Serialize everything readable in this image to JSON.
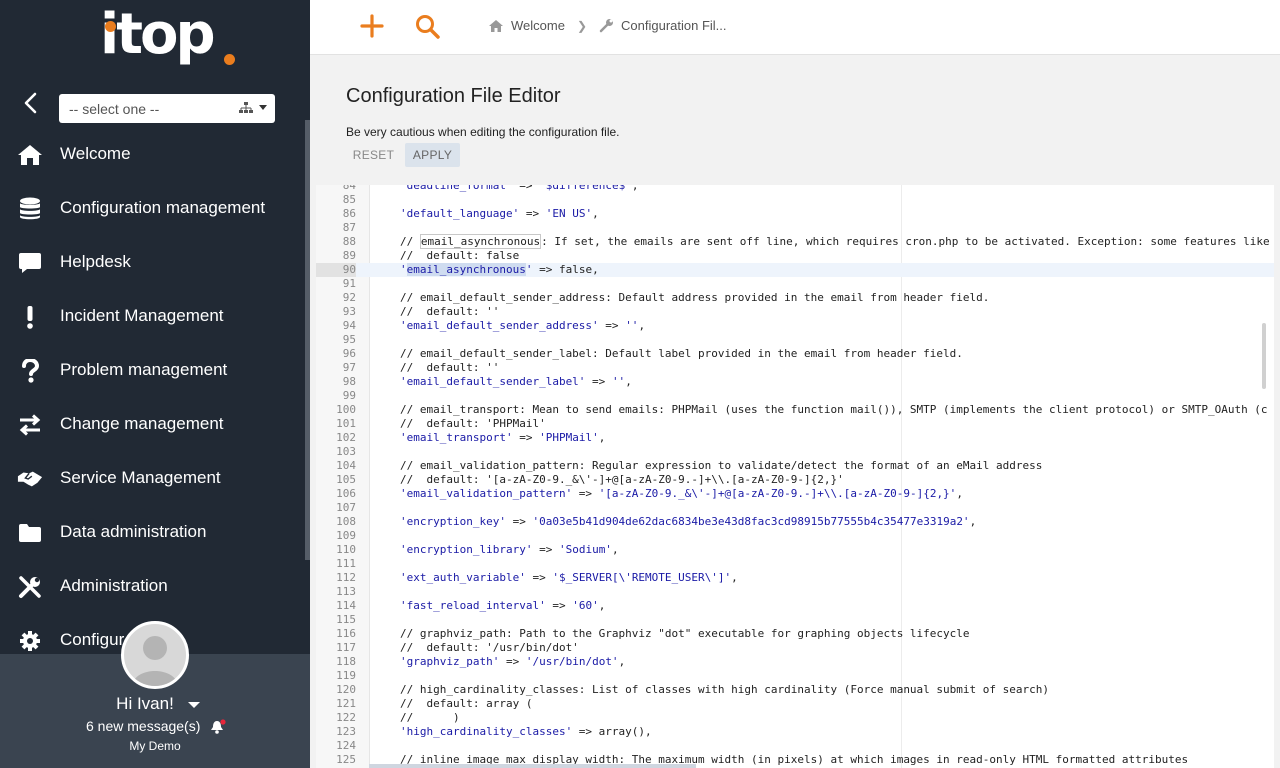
{
  "sidebar": {
    "logo": "itop",
    "org_select": "-- select one --",
    "menu": [
      {
        "label": "Welcome",
        "icon": "home-icon"
      },
      {
        "label": "Configuration management",
        "icon": "database-icon"
      },
      {
        "label": "Helpdesk",
        "icon": "chat-icon"
      },
      {
        "label": "Incident Management",
        "icon": "exclamation-icon"
      },
      {
        "label": "Problem management",
        "icon": "question-icon"
      },
      {
        "label": "Change management",
        "icon": "exchange-icon"
      },
      {
        "label": "Service Management",
        "icon": "handshake-icon"
      },
      {
        "label": "Data administration",
        "icon": "folder-icon"
      },
      {
        "label": "Administration",
        "icon": "tools-icon"
      },
      {
        "label": "Configur",
        "icon": "gear-icon"
      }
    ],
    "user": {
      "greeting": "Hi Ivan!",
      "messages": "6 new message(s)",
      "org": "My Demo"
    }
  },
  "topbar": {
    "breadcrumbs": [
      "Welcome",
      "Configuration Fil..."
    ]
  },
  "page": {
    "title": "Configuration File Editor",
    "warning": "Be very cautious when editing the configuration file.",
    "reset_label": "RESET",
    "apply_label": "APPLY"
  },
  "editor": {
    "active_line": 90,
    "lines": [
      {
        "n": "84",
        "t": "'deadline_format' => '$difference$',"
      },
      {
        "n": "85",
        "t": ""
      },
      {
        "n": "86",
        "t": "'default_language' => 'EN US',"
      },
      {
        "n": "87",
        "t": ""
      },
      {
        "n": "88",
        "t": "// email_asynchronous: If set, the emails are sent off line, which requires cron.php to be activated. Exception: some features like"
      },
      {
        "n": "89",
        "t": "//  default: false"
      },
      {
        "n": "90",
        "t": "'email_asynchronous' => false,"
      },
      {
        "n": "91",
        "t": ""
      },
      {
        "n": "92",
        "t": "// email_default_sender_address: Default address provided in the email from header field."
      },
      {
        "n": "93",
        "t": "//  default: ''"
      },
      {
        "n": "94",
        "t": "'email_default_sender_address' => '',"
      },
      {
        "n": "95",
        "t": ""
      },
      {
        "n": "96",
        "t": "// email_default_sender_label: Default label provided in the email from header field."
      },
      {
        "n": "97",
        "t": "//  default: ''"
      },
      {
        "n": "98",
        "t": "'email_default_sender_label' => '',"
      },
      {
        "n": "99",
        "t": ""
      },
      {
        "n": "100",
        "t": "// email_transport: Mean to send emails: PHPMail (uses the function mail()), SMTP (implements the client protocol) or SMTP_OAuth (c"
      },
      {
        "n": "101",
        "t": "//  default: 'PHPMail'"
      },
      {
        "n": "102",
        "t": "'email_transport' => 'PHPMail',"
      },
      {
        "n": "103",
        "t": ""
      },
      {
        "n": "104",
        "t": "// email_validation_pattern: Regular expression to validate/detect the format of an eMail address"
      },
      {
        "n": "105",
        "t": "//  default: '[a-zA-Z0-9._&\\'-]+@[a-zA-Z0-9.-]+\\\\.[a-zA-Z0-9-]{2,}'"
      },
      {
        "n": "106",
        "t": "'email_validation_pattern' => '[a-zA-Z0-9._&\\'-]+@[a-zA-Z0-9.-]+\\\\.[a-zA-Z0-9-]{2,}',"
      },
      {
        "n": "107",
        "t": ""
      },
      {
        "n": "108",
        "t": "'encryption_key' => '0a03e5b41d904de62dac6834be3e43d8fac3cd98915b77555b4c35477e3319a2',"
      },
      {
        "n": "109",
        "t": ""
      },
      {
        "n": "110",
        "t": "'encryption_library' => 'Sodium',"
      },
      {
        "n": "111",
        "t": ""
      },
      {
        "n": "112",
        "t": "'ext_auth_variable' => '$_SERVER[\\'REMOTE_USER\\']',"
      },
      {
        "n": "113",
        "t": ""
      },
      {
        "n": "114",
        "t": "'fast_reload_interval' => '60',"
      },
      {
        "n": "115",
        "t": ""
      },
      {
        "n": "116",
        "t": "// graphviz_path: Path to the Graphviz \"dot\" executable for graphing objects lifecycle"
      },
      {
        "n": "117",
        "t": "//  default: '/usr/bin/dot'"
      },
      {
        "n": "118",
        "t": "'graphviz_path' => '/usr/bin/dot',"
      },
      {
        "n": "119",
        "t": ""
      },
      {
        "n": "120",
        "t": "// high_cardinality_classes: List of classes with high cardinality (Force manual submit of search)"
      },
      {
        "n": "121",
        "t": "//  default: array ("
      },
      {
        "n": "122",
        "t": "//      )"
      },
      {
        "n": "123",
        "t": "'high_cardinality_classes' => array(),"
      },
      {
        "n": "124",
        "t": ""
      },
      {
        "n": "125",
        "t": "// inline_image_max_display_width: The maximum width (in pixels) at which images in read-only HTML formatted attributes"
      }
    ]
  }
}
